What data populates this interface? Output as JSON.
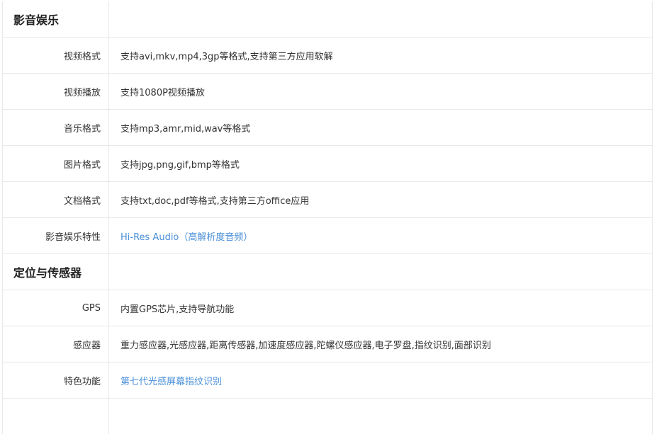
{
  "colors": {
    "border": "#e8e8e8",
    "text": "#333333",
    "link": "#4a90d9"
  },
  "sections": [
    {
      "title": "影音娱乐",
      "rows": [
        {
          "label": "视频格式",
          "value": "支持avi,mkv,mp4,3gp等格式,支持第三方应用软解"
        },
        {
          "label": "视频播放",
          "value": "支持1080P视频播放"
        },
        {
          "label": "音乐格式",
          "value": "支持mp3,amr,mid,wav等格式"
        },
        {
          "label": "图片格式",
          "value": "支持jpg,png,gif,bmp等格式"
        },
        {
          "label": "文档格式",
          "value": "支持txt,doc,pdf等格式,支持第三方office应用"
        },
        {
          "label": "影音娱乐特性",
          "value": "Hi-Res Audio（高解析度音频）"
        }
      ]
    },
    {
      "title": "定位与传感器",
      "rows": [
        {
          "label": "GPS",
          "value": "内置GPS芯片,支持导航功能"
        },
        {
          "label": "感应器",
          "value": "重力感应器,光感应器,距离传感器,加速度感应器,陀螺仪感应器,电子罗盘,指纹识别,面部识别"
        },
        {
          "label": "特色功能",
          "value": "第七代光感屏幕指纹识别"
        }
      ]
    }
  ]
}
